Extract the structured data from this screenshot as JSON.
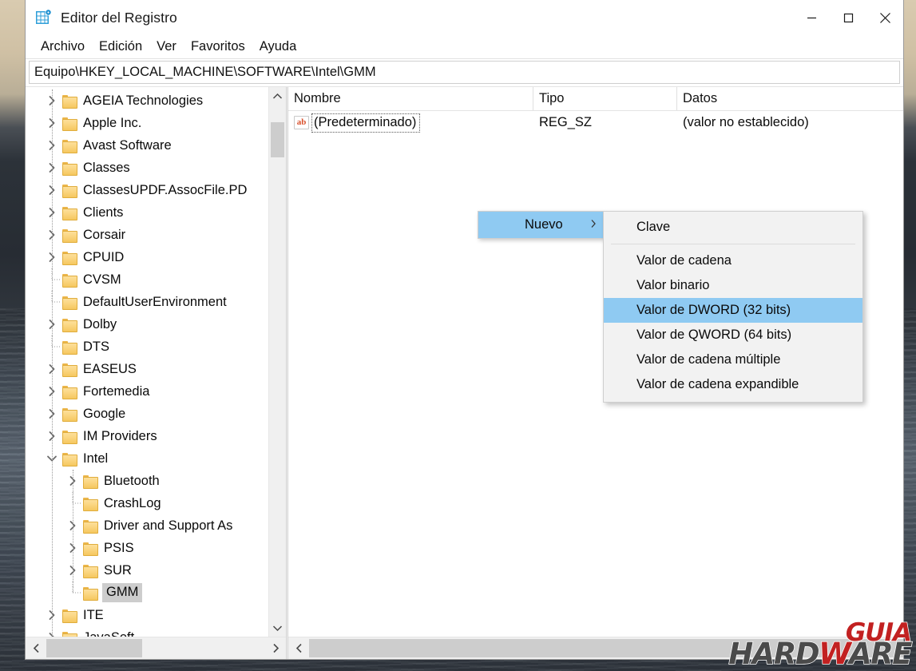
{
  "window": {
    "title": "Editor del Registro",
    "app_icon": "registry-editor-icon",
    "controls": {
      "minimize": "minimize-icon",
      "maximize": "maximize-icon",
      "close": "close-icon"
    }
  },
  "menubar": {
    "items": [
      {
        "label": "Archivo"
      },
      {
        "label": "Edición"
      },
      {
        "label": "Ver"
      },
      {
        "label": "Favoritos"
      },
      {
        "label": "Ayuda"
      }
    ]
  },
  "addressbar": {
    "value": "Equipo\\HKEY_LOCAL_MACHINE\\SOFTWARE\\Intel\\GMM"
  },
  "tree": {
    "items": [
      {
        "label": "AGEIA Technologies",
        "depth": 1,
        "expandable": true,
        "expanded": false,
        "selected": false
      },
      {
        "label": "Apple Inc.",
        "depth": 1,
        "expandable": true,
        "expanded": false,
        "selected": false
      },
      {
        "label": "Avast Software",
        "depth": 1,
        "expandable": true,
        "expanded": false,
        "selected": false
      },
      {
        "label": "Classes",
        "depth": 1,
        "expandable": true,
        "expanded": false,
        "selected": false
      },
      {
        "label": "ClassesUPDF.AssocFile.PD",
        "depth": 1,
        "expandable": true,
        "expanded": false,
        "selected": false
      },
      {
        "label": "Clients",
        "depth": 1,
        "expandable": true,
        "expanded": false,
        "selected": false
      },
      {
        "label": "Corsair",
        "depth": 1,
        "expandable": true,
        "expanded": false,
        "selected": false
      },
      {
        "label": "CPUID",
        "depth": 1,
        "expandable": true,
        "expanded": false,
        "selected": false
      },
      {
        "label": "CVSM",
        "depth": 1,
        "expandable": false,
        "expanded": false,
        "selected": false
      },
      {
        "label": "DefaultUserEnvironment",
        "depth": 1,
        "expandable": false,
        "expanded": false,
        "selected": false
      },
      {
        "label": "Dolby",
        "depth": 1,
        "expandable": true,
        "expanded": false,
        "selected": false
      },
      {
        "label": "DTS",
        "depth": 1,
        "expandable": false,
        "expanded": false,
        "selected": false
      },
      {
        "label": "EASEUS",
        "depth": 1,
        "expandable": true,
        "expanded": false,
        "selected": false
      },
      {
        "label": "Fortemedia",
        "depth": 1,
        "expandable": true,
        "expanded": false,
        "selected": false
      },
      {
        "label": "Google",
        "depth": 1,
        "expandable": true,
        "expanded": false,
        "selected": false
      },
      {
        "label": "IM Providers",
        "depth": 1,
        "expandable": true,
        "expanded": false,
        "selected": false
      },
      {
        "label": "Intel",
        "depth": 1,
        "expandable": true,
        "expanded": true,
        "selected": false
      },
      {
        "label": "Bluetooth",
        "depth": 2,
        "expandable": true,
        "expanded": false,
        "selected": false
      },
      {
        "label": "CrashLog",
        "depth": 2,
        "expandable": false,
        "expanded": false,
        "selected": false
      },
      {
        "label": "Driver and Support As",
        "depth": 2,
        "expandable": true,
        "expanded": false,
        "selected": false
      },
      {
        "label": "PSIS",
        "depth": 2,
        "expandable": true,
        "expanded": false,
        "selected": false
      },
      {
        "label": "SUR",
        "depth": 2,
        "expandable": true,
        "expanded": false,
        "selected": false
      },
      {
        "label": "GMM",
        "depth": 2,
        "expandable": false,
        "expanded": false,
        "selected": true
      },
      {
        "label": "ITE",
        "depth": 1,
        "expandable": true,
        "expanded": false,
        "selected": false
      },
      {
        "label": "JavaSoft",
        "depth": 1,
        "expandable": true,
        "expanded": false,
        "selected": false
      }
    ]
  },
  "list": {
    "columns": [
      {
        "label": "Nombre"
      },
      {
        "label": "Tipo"
      },
      {
        "label": "Datos"
      }
    ],
    "rows": [
      {
        "icon": "string-value-icon",
        "icon_text": "ab",
        "name": "(Predeterminado)",
        "type": "REG_SZ",
        "data": "(valor no establecido)",
        "focused": true
      }
    ]
  },
  "context_menu": {
    "parent": {
      "label": "Nuevo",
      "submenu_arrow": "chevron-right-icon",
      "highlighted": true
    },
    "submenu": {
      "items": [
        {
          "label": "Clave",
          "highlighted": false,
          "separator_after": true
        },
        {
          "label": "Valor de cadena",
          "highlighted": false,
          "separator_after": false
        },
        {
          "label": "Valor binario",
          "highlighted": false,
          "separator_after": false
        },
        {
          "label": "Valor de DWORD (32 bits)",
          "highlighted": true,
          "separator_after": false
        },
        {
          "label": "Valor de QWORD (64 bits)",
          "highlighted": false,
          "separator_after": false
        },
        {
          "label": "Valor de cadena múltiple",
          "highlighted": false,
          "separator_after": false
        },
        {
          "label": "Valor de cadena expandible",
          "highlighted": false,
          "separator_after": false
        }
      ]
    }
  },
  "scrollbars": {
    "tree_vertical": {
      "up": "chevron-up-icon",
      "down": "chevron-down-icon"
    },
    "tree_horizontal": {
      "left": "chevron-left-icon",
      "right": "chevron-right-icon"
    },
    "list_horizontal": {
      "left": "chevron-left-icon"
    }
  },
  "watermark": {
    "line1": "GUIA",
    "line2_pre": "HARD",
    "line2_w": "W",
    "line2_post": "ARE"
  },
  "colors": {
    "menu_highlight": "#8fcaf2",
    "selection_grey": "#cdcdcd",
    "folder_yellow": "#f5c75f",
    "watermark_red": "#c22121",
    "watermark_grey": "#4a4a4a"
  }
}
